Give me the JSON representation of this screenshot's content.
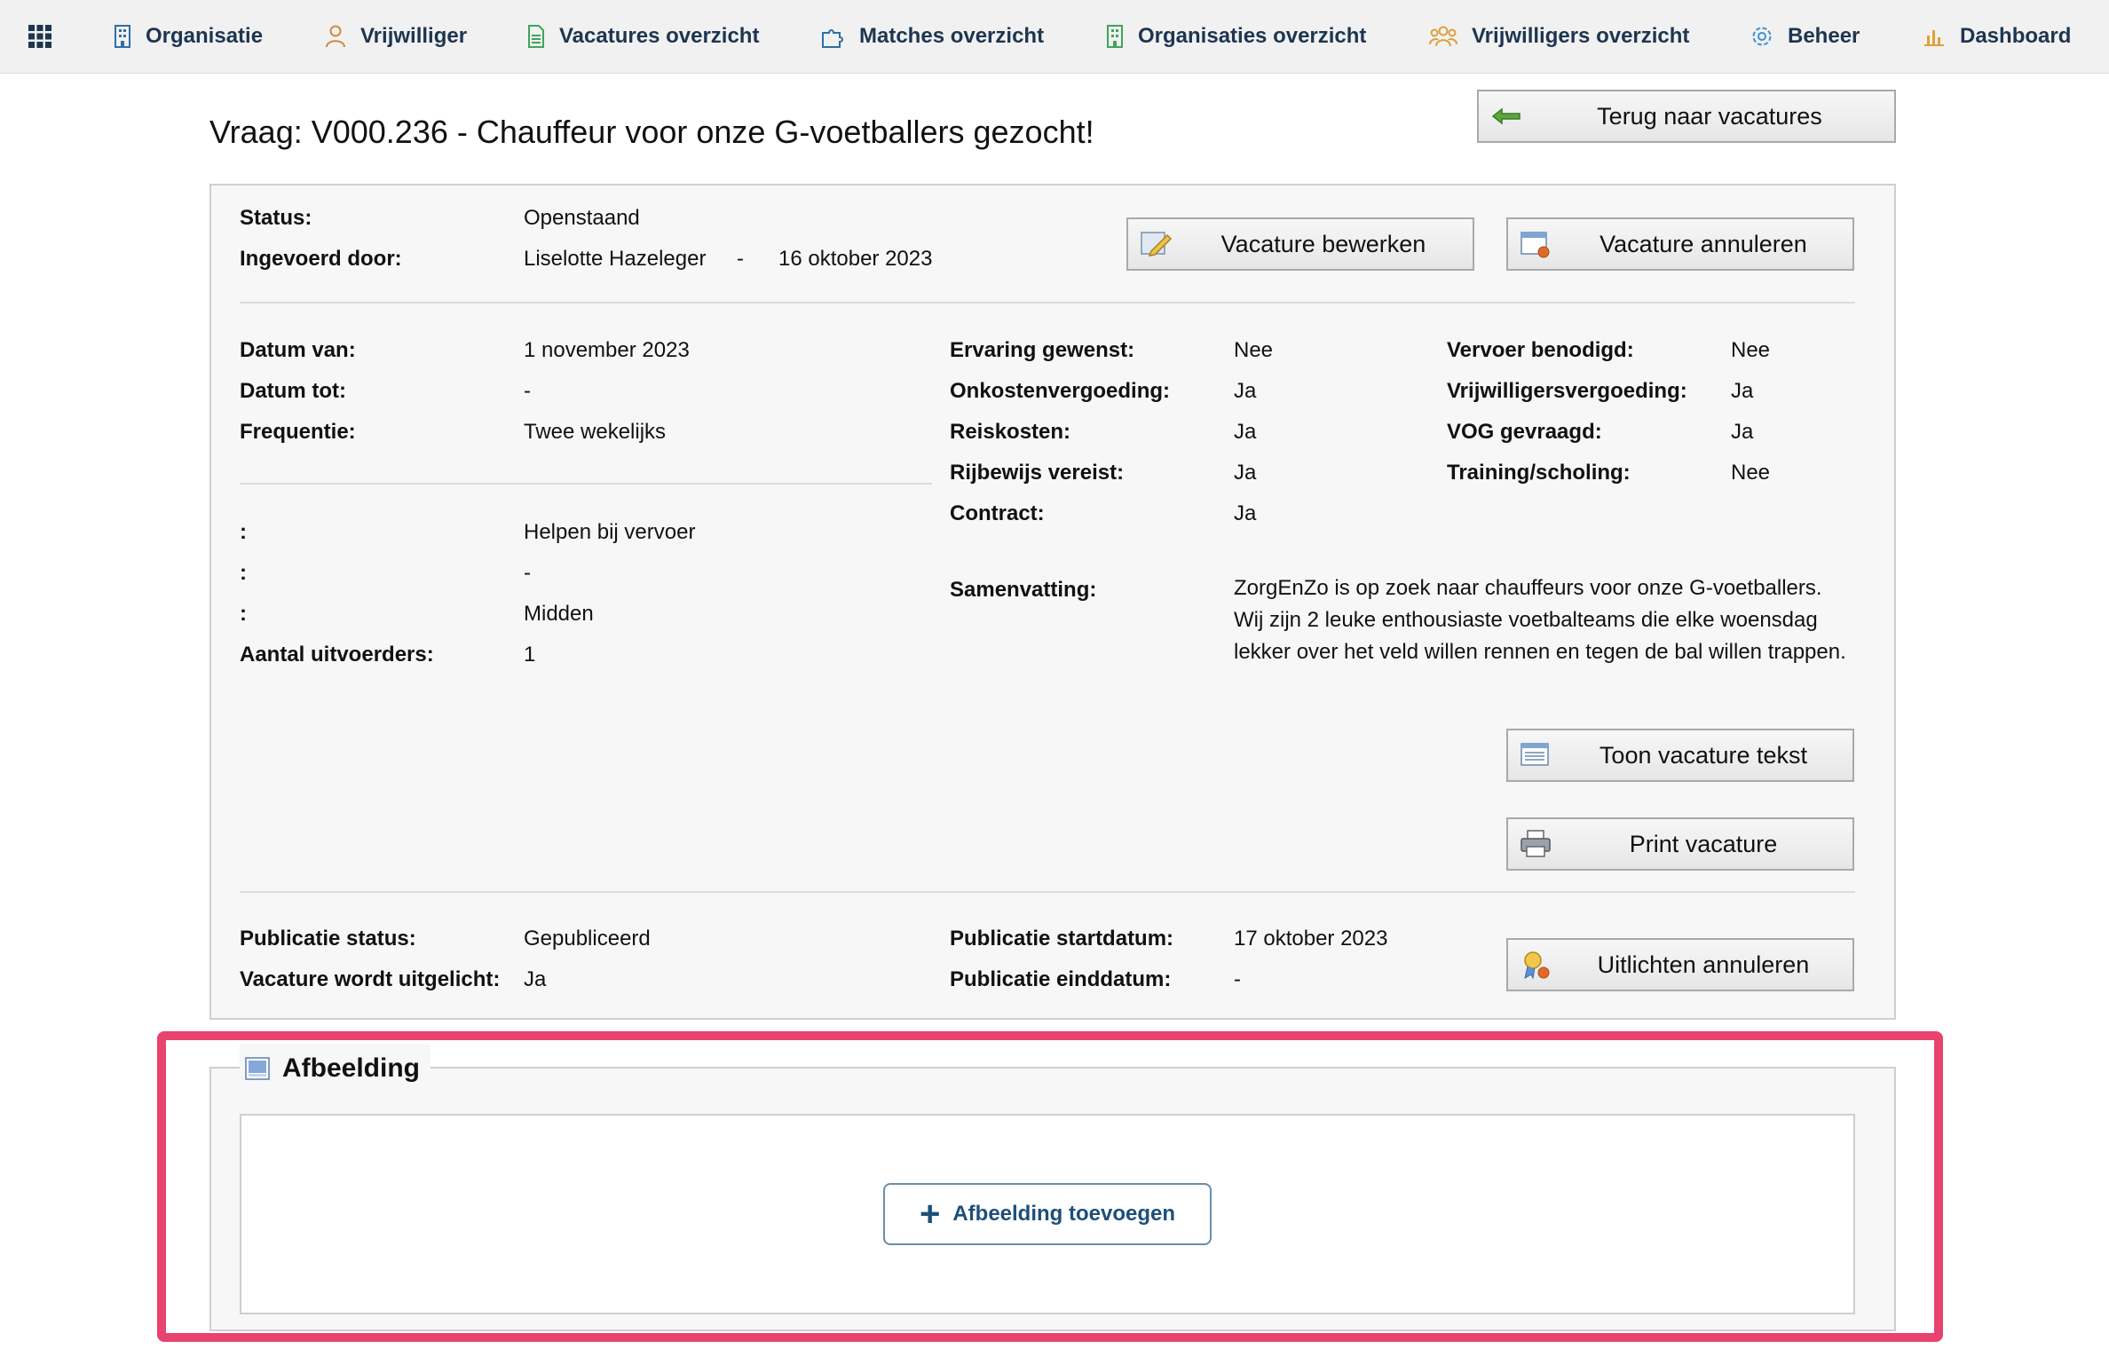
{
  "nav": {
    "items": [
      {
        "label": "Organisatie",
        "icon": "building-icon"
      },
      {
        "label": "Vrijwilliger",
        "icon": "person-icon"
      },
      {
        "label": "Vacatures overzicht",
        "icon": "document-icon"
      },
      {
        "label": "Matches overzicht",
        "icon": "puzzle-icon"
      },
      {
        "label": "Organisaties overzicht",
        "icon": "building-icon"
      },
      {
        "label": "Vrijwilligers overzicht",
        "icon": "group-icon"
      },
      {
        "label": "Beheer",
        "icon": "gear-icon"
      },
      {
        "label": "Dashboard",
        "icon": "bar-chart-icon"
      }
    ]
  },
  "page": {
    "title": "Vraag: V000.236 - Chauffeur voor onze G-voetballers gezocht!",
    "back_button": "Terug naar vacatures"
  },
  "header": {
    "status_label": "Status:",
    "status_value": "Openstaand",
    "entered_by_label": "Ingevoerd door:",
    "entered_by_value": "Liselotte Hazeleger",
    "separator": "-",
    "entered_date": "16 oktober 2023",
    "edit_button": "Vacature bewerken",
    "cancel_button": "Vacature annuleren"
  },
  "details": {
    "date_from_label": "Datum van:",
    "date_from_value": "1 november 2023",
    "date_to_label": "Datum tot:",
    "date_to_value": "-",
    "frequency_label": "Frequentie:",
    "frequency_value": "Twee wekelijks",
    "extra": [
      {
        "label": ":",
        "value": "Helpen bij vervoer"
      },
      {
        "label": ":",
        "value": "-"
      },
      {
        "label": ":",
        "value": "Midden"
      }
    ],
    "performers_label": "Aantal uitvoerders:",
    "performers_value": "1"
  },
  "requirements": {
    "col1": [
      {
        "label": "Ervaring gewenst:",
        "value": "Nee"
      },
      {
        "label": "Onkostenvergoeding:",
        "value": "Ja"
      },
      {
        "label": "Reiskosten:",
        "value": "Ja"
      },
      {
        "label": "Rijbewijs vereist:",
        "value": "Ja"
      },
      {
        "label": "Contract:",
        "value": "Ja"
      }
    ],
    "col2": [
      {
        "label": "Vervoer benodigd:",
        "value": "Nee"
      },
      {
        "label": "Vrijwilligersvergoeding:",
        "value": "Ja"
      },
      {
        "label": "VOG gevraagd:",
        "value": "Ja"
      },
      {
        "label": "Training/scholing:",
        "value": "Nee"
      }
    ],
    "summary_label": "Samenvatting:",
    "summary_lines": [
      "ZorgEnZo is op zoek naar chauffeurs voor onze G-voetballers.",
      "Wij zijn 2 leuke enthousiaste voetbalteams die elke woensdag",
      "lekker over het veld willen rennen en tegen de bal willen trappen."
    ],
    "show_text_button": "Toon vacature tekst",
    "print_button": "Print vacature"
  },
  "publication": {
    "status_label": "Publicatie status:",
    "status_value": "Gepubliceerd",
    "featured_label": "Vacature wordt uitgelicht:",
    "featured_value": "Ja",
    "start_label": "Publicatie startdatum:",
    "start_value": "17 oktober 2023",
    "end_label": "Publicatie einddatum:",
    "end_value": "-",
    "unfeature_button": "Uitlichten annuleren"
  },
  "image_section": {
    "legend": "Afbeelding",
    "add_button": "Afbeelding toevoegen"
  },
  "colors": {
    "nav_text": "#1d3550",
    "highlight": "#e8436e",
    "accent_blue": "#1d4f79"
  }
}
